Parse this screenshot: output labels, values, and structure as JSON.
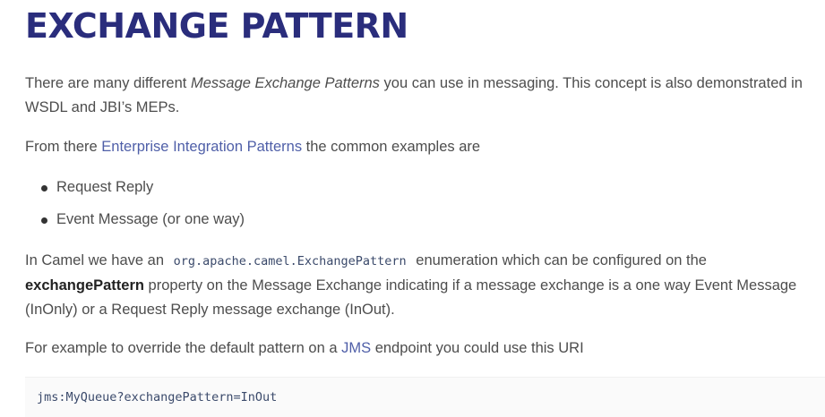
{
  "heading": "EXCHANGE PATTERN",
  "para1": {
    "pre": "There are many different ",
    "em": "Message Exchange Patterns",
    "post": " you can use in messaging. This concept is also demonstrated in WSDL and JBI’s MEPs."
  },
  "para2": {
    "pre": "From there ",
    "link": "Enterprise Integration Patterns",
    "post": " the common examples are"
  },
  "list": [
    "Request Reply",
    "Event Message (or one way)"
  ],
  "para3": {
    "pre": "In Camel we have an ",
    "code": "org.apache.camel.ExchangePattern",
    "mid": " enumeration which can be configured on the ",
    "strong": "exchangePattern",
    "post": " property on the Message Exchange indicating if a message exchange is a one way Event Message (InOnly) or a Request Reply message exchange (InOut)."
  },
  "para4": {
    "pre": "For example to override the default pattern on a ",
    "link": "JMS",
    "post": " endpoint you could use this URI"
  },
  "code_block": "jms:MyQueue?exchangePattern=InOut",
  "colors": {
    "heading": "#2a2d7c",
    "link": "#4f5fa8",
    "text": "#4d4d4d",
    "code": "#3b4a6b"
  }
}
